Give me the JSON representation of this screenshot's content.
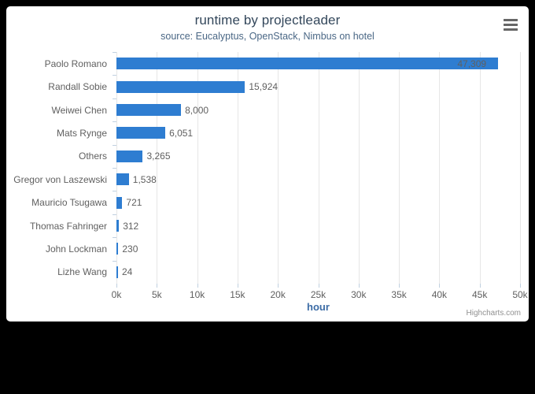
{
  "card": {
    "background": "#ffffff",
    "page_background": "#000000"
  },
  "context_menu": {
    "name": "chart-context-menu",
    "icon": "hamburger-icon"
  },
  "credits": {
    "text": "Highcharts.com"
  },
  "chart_data": {
    "type": "bar",
    "title": "runtime by projectleader",
    "subtitle": "source: Eucalyptus, OpenStack, Nimbus on hotel",
    "xlabel": "hour",
    "ylabel": "",
    "orientation": "horizontal",
    "grid": true,
    "legend": false,
    "bar_color": "#2e7dd1",
    "data_label_color": "#606060",
    "axis_range": [
      0,
      50000
    ],
    "tick_interval": 5000,
    "tick_labels": [
      "0k",
      "5k",
      "10k",
      "15k",
      "20k",
      "25k",
      "30k",
      "35k",
      "40k",
      "45k",
      "50k"
    ],
    "categories": [
      "Paolo Romano",
      "Randall Sobie",
      "Weiwei Chen",
      "Mats Rynge",
      "Others",
      "Gregor von Laszewski",
      "Mauricio Tsugawa",
      "Thomas Fahringer",
      "John Lockman",
      "Lizhe Wang"
    ],
    "values": [
      47309,
      15924,
      8000,
      6051,
      3265,
      1538,
      721,
      312,
      230,
      24
    ],
    "data_labels": [
      "47,309",
      "15,924",
      "8,000",
      "6,051",
      "3,265",
      "1,538",
      "721",
      "312",
      "230",
      "24"
    ],
    "data_label_position": [
      "inside",
      "outside",
      "outside",
      "outside",
      "outside",
      "outside",
      "outside",
      "outside",
      "outside",
      "outside"
    ]
  }
}
